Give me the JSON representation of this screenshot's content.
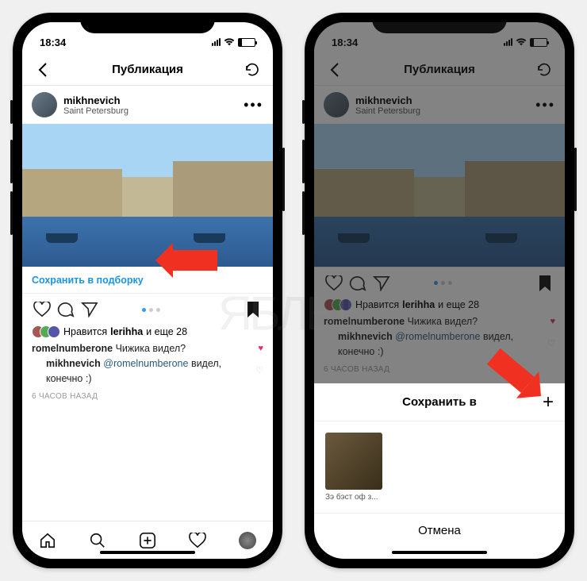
{
  "status": {
    "time": "18:34"
  },
  "nav": {
    "title": "Публикация"
  },
  "post": {
    "username": "mikhnevich",
    "location": "Saint Petersburg",
    "save_to_collection": "Сохранить в подборку",
    "likes_prefix": "Нравится",
    "likes_user": "lerihha",
    "likes_suffix": "и еще 28",
    "comment1_user": "romelnumberone",
    "comment1_text": "Чижика видел?",
    "reply_user": "mikhnevich",
    "reply_mention": "@romelnumberone",
    "reply_text": "видел, конечно :)",
    "time_ago": "6 ЧАСОВ НАЗАД"
  },
  "sheet": {
    "title": "Сохранить в",
    "collection_name": "Зэ бэст оф з...",
    "cancel": "Отмена"
  },
  "watermark": "ЯБЛЫК"
}
